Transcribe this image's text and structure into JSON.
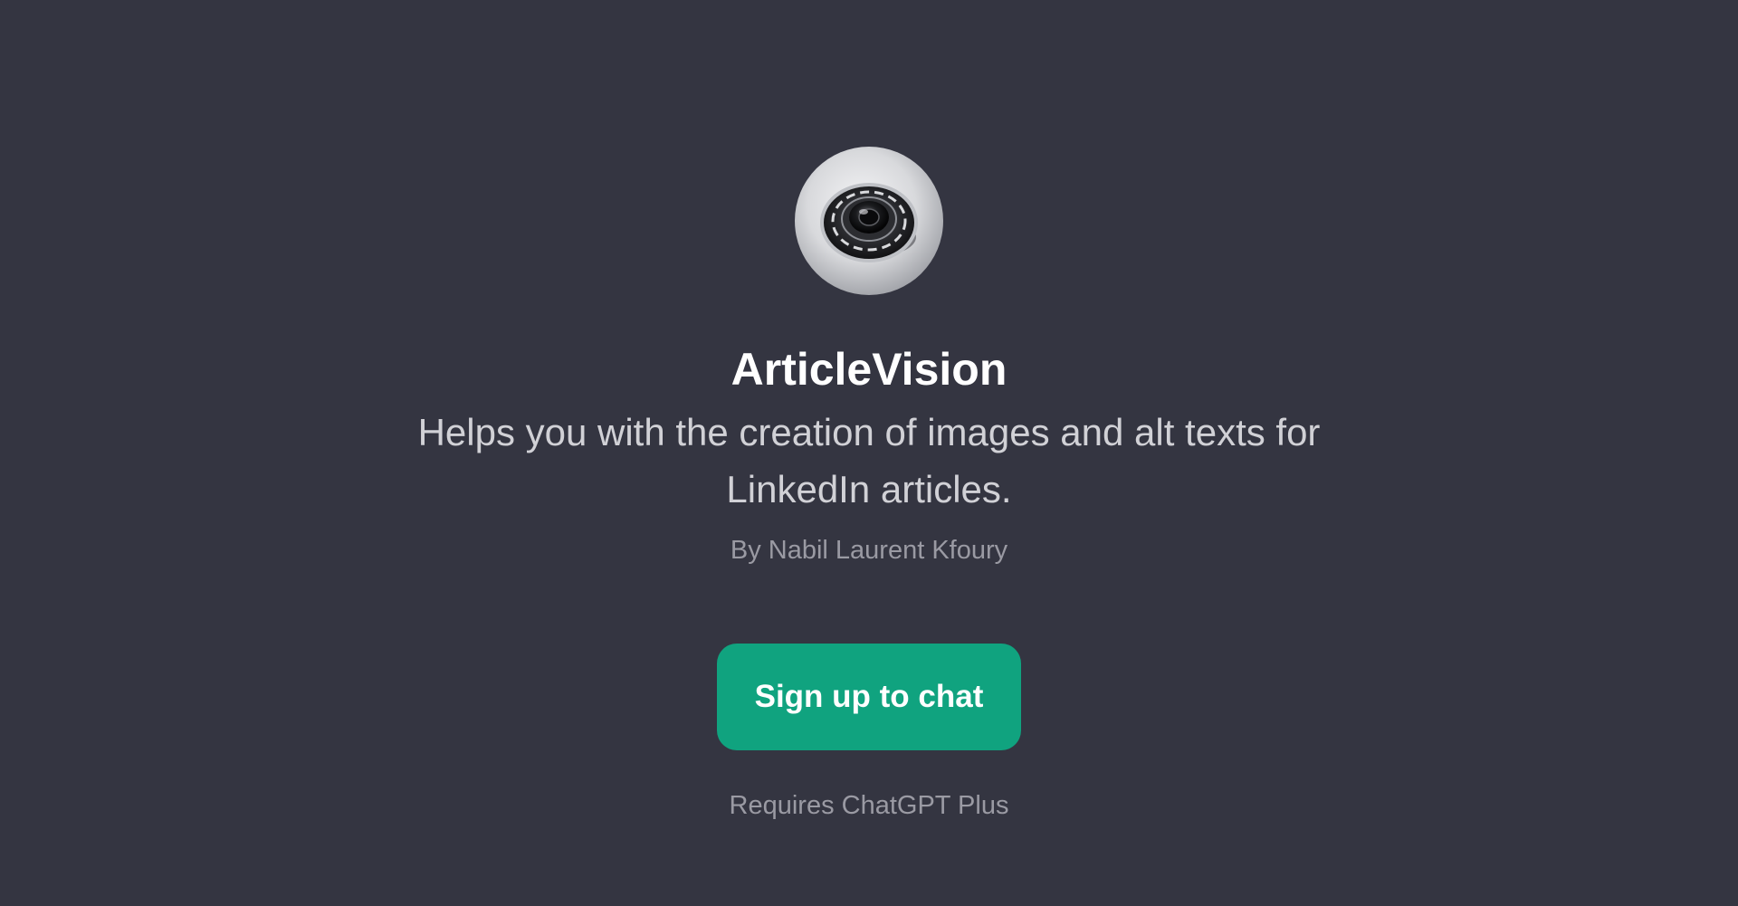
{
  "gpt": {
    "avatar_icon": "camera-lens-icon",
    "name": "ArticleVision",
    "description": "Helps you with the creation of images and alt texts for LinkedIn articles.",
    "author": "By Nabil Laurent Kfoury"
  },
  "cta": {
    "label": "Sign up to chat",
    "color": "#10a37f"
  },
  "footer": {
    "requires": "Requires ChatGPT Plus"
  },
  "colors": {
    "background": "#343541",
    "title": "#ffffff",
    "subtitle": "#d1d1d6",
    "muted": "#9a9aa3"
  }
}
